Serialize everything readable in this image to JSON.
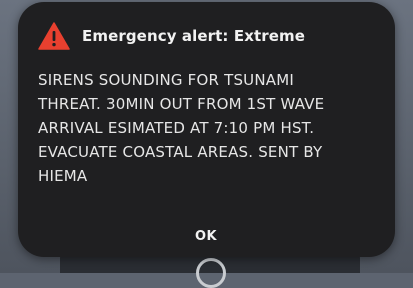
{
  "alert": {
    "title": "Emergency alert: Extreme",
    "icon": "warning-triangle-icon",
    "message": "SIRENS SOUNDING FOR TSUNAMI\nTHREAT. 30MIN OUT FROM 1ST WAVE\nARRIVAL ESIMATED AT 7:10 PM HST.\nEVACUATE COASTAL AREAS. SENT BY\nHIEMA",
    "ok_label": "OK"
  },
  "colors": {
    "icon_red": "#e8402f",
    "dialog_bg": "#1f1f21",
    "text": "#e6e6e6"
  }
}
